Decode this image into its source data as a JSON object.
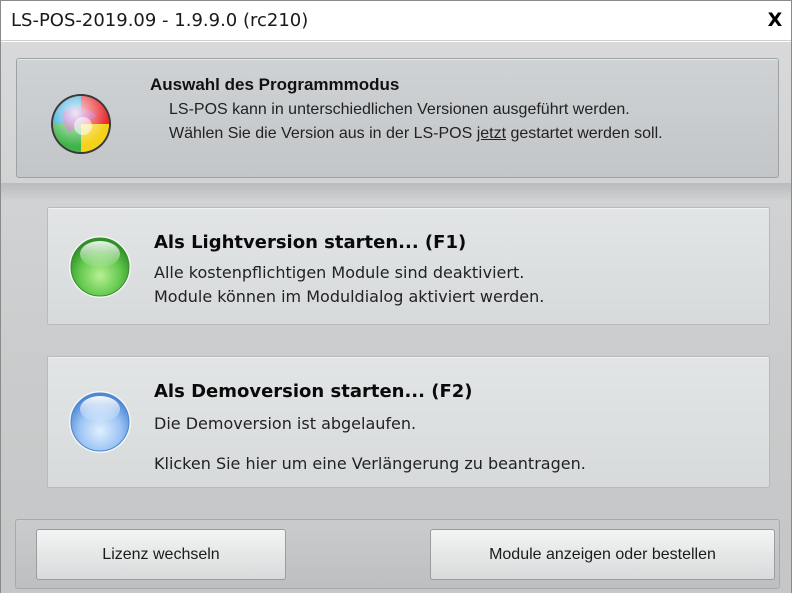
{
  "window": {
    "title": "LS-POS-2019.09 - 1.9.9.0 (rc210)",
    "close_label": "X"
  },
  "header": {
    "title": "Auswahl des Programmmodus",
    "line1": "LS-POS kann in unterschiedlichen Versionen ausgeführt werden.",
    "line2_before": "Wählen Sie die Version aus in der LS-POS ",
    "line2_underlined": "jetzt",
    "line2_after": " gestartet werden soll.",
    "icon": "multicolor-sphere-icon"
  },
  "options": {
    "light": {
      "title": "Als Lightversion starten... (F1)",
      "line1": "Alle kostenpflichtigen Module sind deaktiviert.",
      "line2": "Module können im Moduldialog aktiviert werden.",
      "icon": "green-orb-icon",
      "color": "#5cc24a"
    },
    "demo": {
      "title": "Als Demoversion starten... (F2)",
      "line1": "Die Demoversion ist abgelaufen.",
      "line2": "Klicken Sie hier um eine Verlängerung zu beantragen.",
      "icon": "blue-orb-icon",
      "color": "#7fb2ee"
    }
  },
  "footer": {
    "license_button": "Lizenz wechseln",
    "modules_button": "Module anzeigen oder bestellen"
  }
}
